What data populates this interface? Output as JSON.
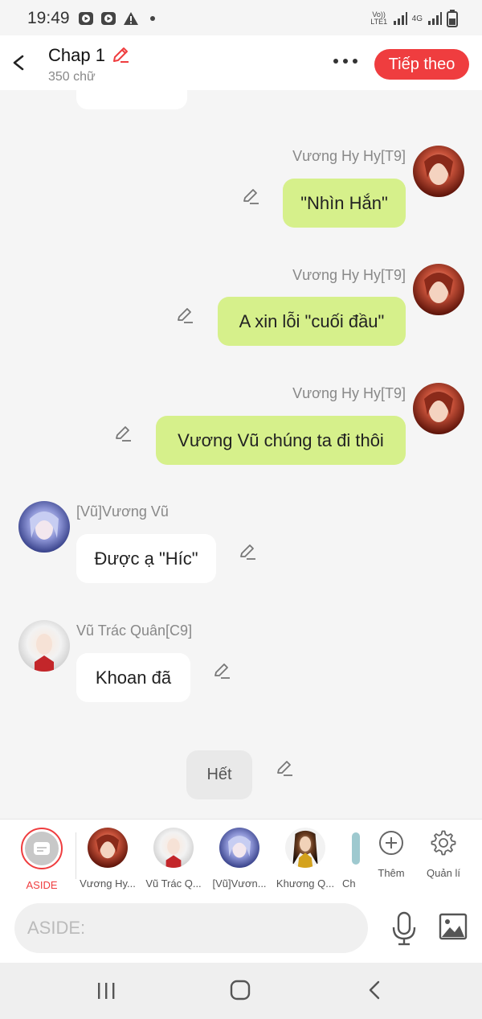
{
  "status_bar": {
    "time": "19:49",
    "network_label_1": "Vo)) LTE1",
    "network_label_2": "4G"
  },
  "header": {
    "title": "Chap 1",
    "word_count": "350 chữ",
    "next_label": "Tiếp theo"
  },
  "messages": [
    {
      "side": "right",
      "sender": "Vương Hy Hy[T9]",
      "text": "\"Nhìn Hắn\""
    },
    {
      "side": "right",
      "sender": "Vương Hy Hy[T9]",
      "text": "A xin lỗi \"cuối đầu\""
    },
    {
      "side": "right",
      "sender": "Vương Hy Hy[T9]",
      "text": "Vương Vũ chúng ta đi thôi"
    },
    {
      "side": "left",
      "sender": "[Vũ]Vương Vũ",
      "text": "Được ạ \"Híc\""
    },
    {
      "side": "left",
      "sender": "Vũ Trác Quân[C9]",
      "text": "Khoan đã"
    }
  ],
  "end_marker": "Hết",
  "characters": [
    {
      "label": "ASIDE",
      "active": true
    },
    {
      "label": "Vương Hy..."
    },
    {
      "label": "Vũ Trác Q..."
    },
    {
      "label": "[Vũ]Vươn..."
    },
    {
      "label": "Khương Q..."
    },
    {
      "label": "Ch"
    }
  ],
  "tools": {
    "add_label": "Thêm",
    "manage_label": "Quản lí"
  },
  "input": {
    "placeholder": "ASIDE:"
  },
  "colors": {
    "accent": "#ef3d3f",
    "bubble_green": "#d6f08b",
    "background": "#f5f5f5"
  },
  "icons": [
    "back-arrow-icon",
    "pencil-icon",
    "more-dots-icon",
    "plus-circle-icon",
    "gear-icon",
    "microphone-icon",
    "image-icon",
    "recents-icon",
    "home-icon",
    "nav-back-icon"
  ]
}
